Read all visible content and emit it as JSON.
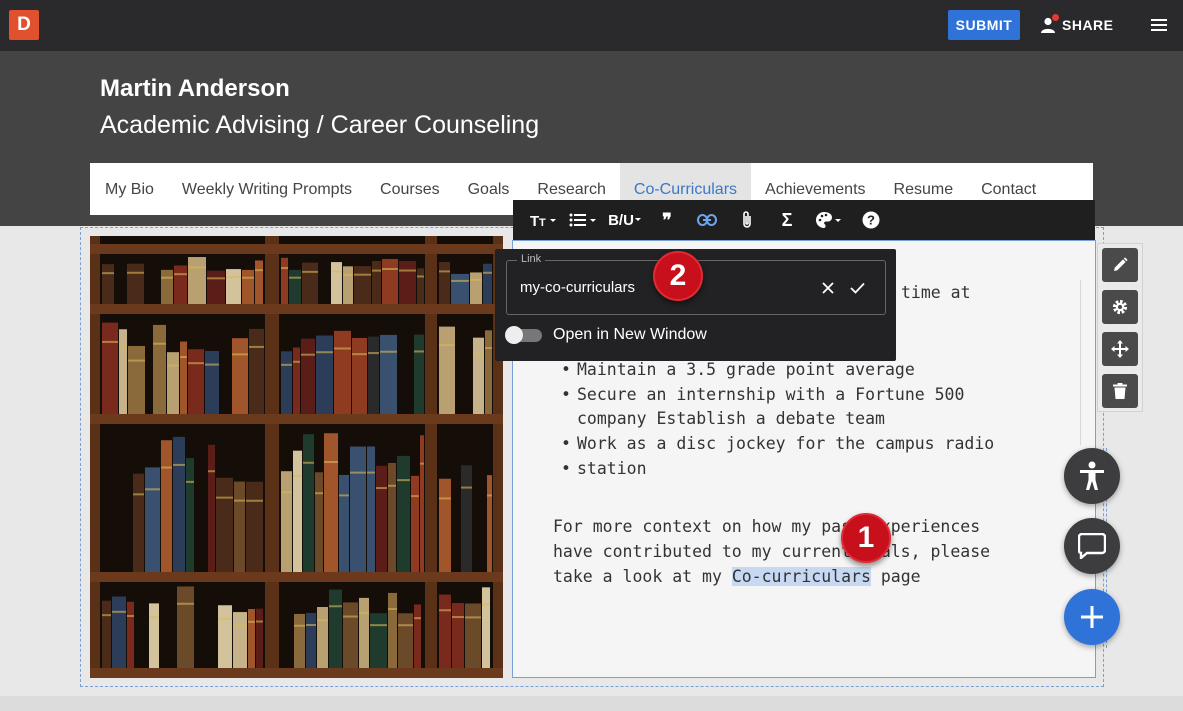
{
  "topbar": {
    "logo_letter": "D",
    "submit_label": "SUBMIT",
    "share_label": "SHARE"
  },
  "header": {
    "name": "Martin Anderson",
    "subtitle": "Academic Advising / Career Counseling"
  },
  "nav": {
    "items": [
      {
        "label": "My Bio"
      },
      {
        "label": "Weekly Writing Prompts"
      },
      {
        "label": "Courses"
      },
      {
        "label": "Goals"
      },
      {
        "label": "Research"
      },
      {
        "label": "Co-Curriculars",
        "active": true
      },
      {
        "label": "Achievements"
      },
      {
        "label": "Resume"
      },
      {
        "label": "Contact"
      }
    ]
  },
  "editor": {
    "toolbar_icons": [
      "text-size-icon",
      "list-icon",
      "bold-underline-icon",
      "quote-icon",
      "link-icon",
      "attachment-icon",
      "sigma-icon",
      "palette-icon",
      "help-icon"
    ],
    "bold_underline_glyph": "B/U",
    "sigma_glyph": "Σ",
    "help_glyph": "?",
    "quote_glyph": "❞",
    "text_fragment": "time at",
    "bullets": [
      "Maintain a 3.5 grade point average",
      "Secure an internship with a Fortune 500 company Establish a debate team",
      "Work as a disc jockey for the campus radio",
      "station"
    ],
    "paragraph_before": "For more context on how my past experiences have contributed to my current goals, please take a look at my ",
    "paragraph_link": "Co-curriculars",
    "paragraph_after": " page"
  },
  "link_popup": {
    "legend": "Link",
    "value": "my-co-curriculars",
    "toggle_label": "Open in New Window",
    "toggle_on": false
  },
  "badges": {
    "one": "1",
    "two": "2"
  },
  "colors": {
    "accent": "#2f73d9",
    "logo": "#e2512e",
    "badge": "#c8101c",
    "link": "#3a78c9"
  }
}
